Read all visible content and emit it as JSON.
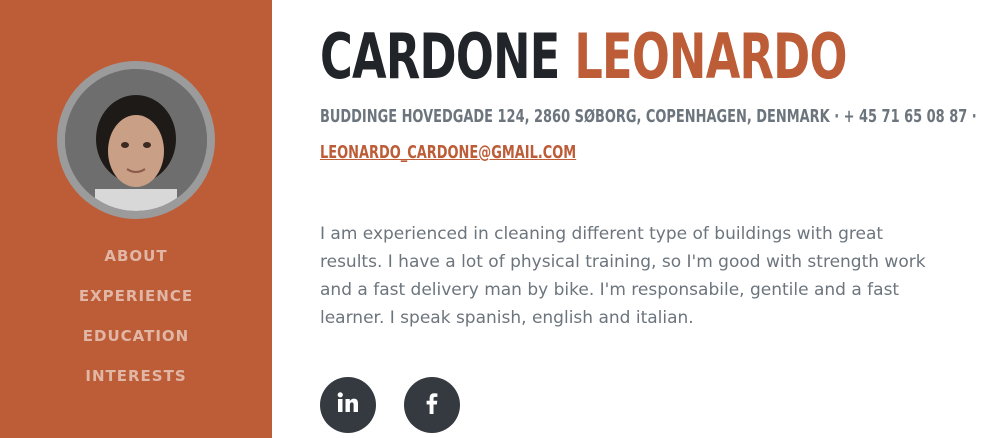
{
  "sidebar": {
    "avatar_alt": "profile photo",
    "nav": [
      {
        "label": "ABOUT"
      },
      {
        "label": "EXPERIENCE"
      },
      {
        "label": "EDUCATION"
      },
      {
        "label": "INTERESTS"
      }
    ]
  },
  "profile": {
    "first_name": "CARDONE",
    "last_name": "LEONARDO",
    "address": "BUDDINGE HOVEDGADE 124, 2860 SØBORG, COPENHAGEN, DENMARK · + 45 71 65 08 87 ·",
    "email": "LEONARDO_CARDONE@GMAIL.COM",
    "bio": "I am experienced in cleaning different type of buildings with great results. I have a lot of physical training, so I'm good with strength work and a fast delivery man by bike. I'm responsabile, gentile and a fast learner. I speak spanish, english and italian."
  },
  "social": [
    {
      "icon": "linkedin-icon"
    },
    {
      "icon": "facebook-icon"
    }
  ],
  "colors": {
    "accent": "#bd5d38",
    "dark": "#212529",
    "muted": "#6c757d",
    "social_bg": "#343a40"
  }
}
